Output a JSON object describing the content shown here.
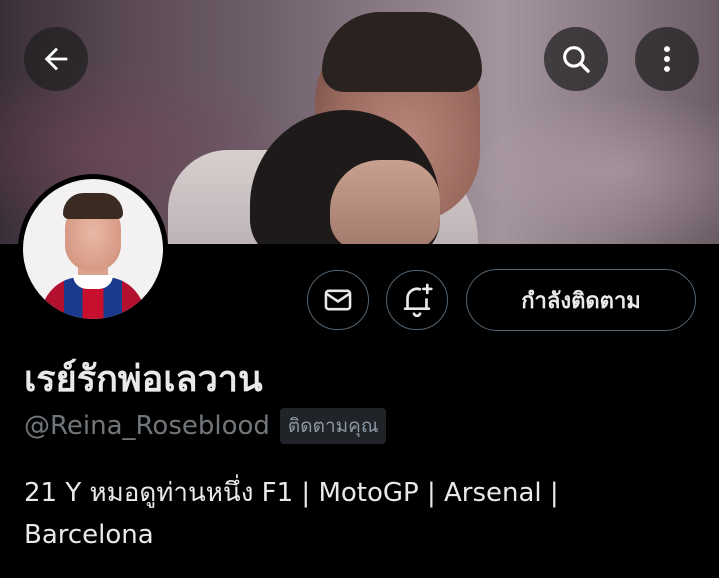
{
  "header": {
    "back_icon": "arrow-left-icon",
    "search_icon": "search-icon",
    "more_icon": "more-vertical-icon"
  },
  "profile": {
    "display_name": "เรย์รักพ่อเลวาน",
    "handle": "@Reina_Roseblood",
    "follows_you_badge": "ติดตามคุณ",
    "bio_line1": "21 Y   หมอดูท่านหนึ่ง F1 | MotoGP | Arsenal |",
    "bio_line2": "Barcelona"
  },
  "actions": {
    "message_icon": "envelope-icon",
    "notify_icon": "bell-plus-icon",
    "following_label": "กำลังติดตาม"
  },
  "colors": {
    "background": "#000000",
    "text_primary": "#e7e9ea",
    "text_secondary": "#71767b",
    "border": "#536471"
  }
}
